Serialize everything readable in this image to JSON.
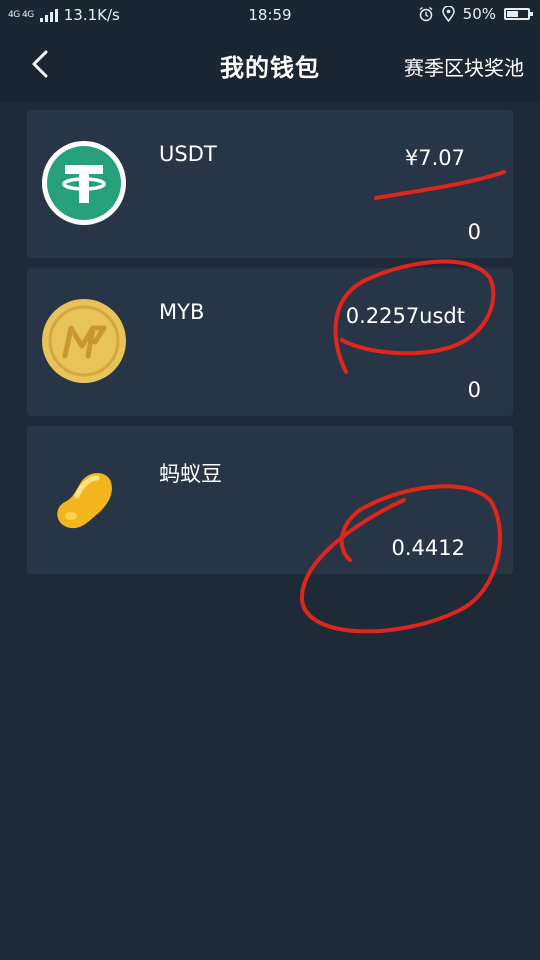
{
  "status_bar": {
    "network_type": "4G 4G",
    "speed": "13.1K/s",
    "time": "18:59",
    "battery": "50%",
    "battery_fraction": 0.5
  },
  "header": {
    "title": "我的钱包",
    "right_link": "赛季区块奖池"
  },
  "wallet_items": [
    {
      "name": "USDT",
      "value": "¥7.07",
      "sub_value": "0"
    },
    {
      "name": "MYB",
      "value": "0.2257usdt",
      "sub_value": "0"
    },
    {
      "name": "蚂蚁豆",
      "value": "0.4412"
    }
  ],
  "colors": {
    "background": "#1f2a38",
    "card": "#283547",
    "usdt_green": "#26a17b",
    "myb_gold": "#e8c35a",
    "bean_yellow": "#f3b61f",
    "annotation_red": "#e0261b"
  }
}
